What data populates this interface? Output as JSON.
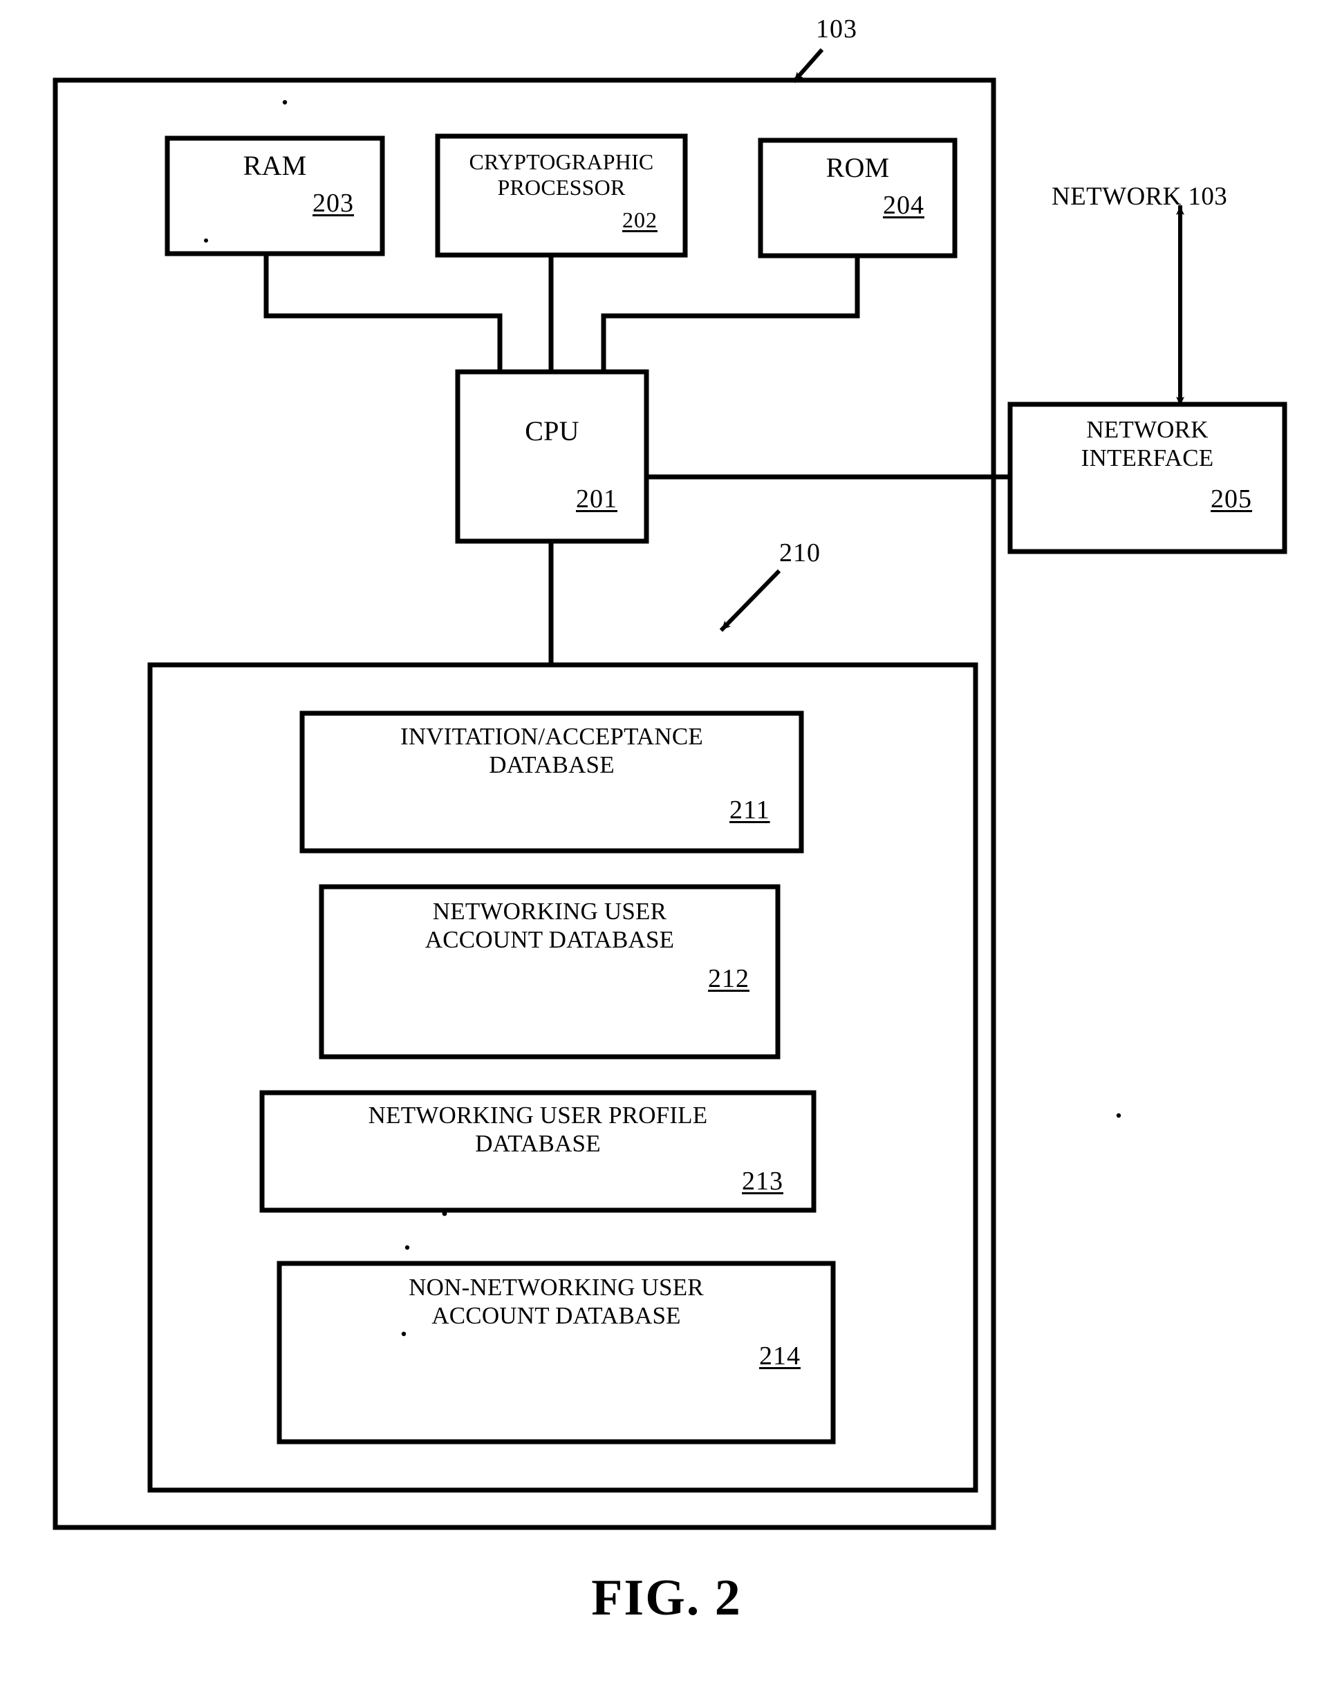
{
  "figure": {
    "caption": "FIG. 2",
    "outer_callout": "103",
    "memory_callout": "210",
    "network_label": "NETWORK 103"
  },
  "components": {
    "ram": {
      "title": "RAM",
      "ref": "203"
    },
    "crypto": {
      "title": "CRYPTOGRAPHIC\nPROCESSOR",
      "ref": "202"
    },
    "rom": {
      "title": "ROM",
      "ref": "204"
    },
    "cpu": {
      "title": "CPU",
      "ref": "201"
    },
    "network_interface": {
      "title": "NETWORK\nINTERFACE",
      "ref": "205"
    }
  },
  "databases": [
    {
      "title": "INVITATION/ACCEPTANCE\nDATABASE",
      "ref": "211"
    },
    {
      "title": "NETWORKING USER\nACCOUNT DATABASE",
      "ref": "212"
    },
    {
      "title": "NETWORKING USER PROFILE\nDATABASE",
      "ref": "213"
    },
    {
      "title": "NON-NETWORKING USER\nACCOUNT DATABASE",
      "ref": "214"
    }
  ],
  "colors": {
    "ink": "#000000",
    "paper": "#ffffff"
  }
}
